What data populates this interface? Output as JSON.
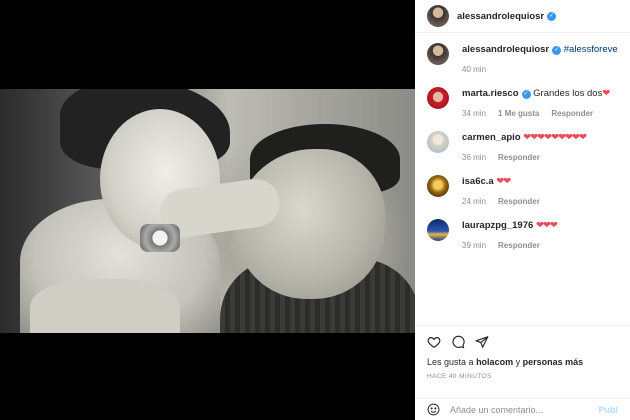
{
  "post_header": {
    "username": "alessandrolequiosr"
  },
  "caption": {
    "username": "alessandrolequiosr",
    "hashtags": "#alessforeve #lequiocity",
    "time": "40 min"
  },
  "comments": [
    {
      "username": "marta.riesco",
      "text": "Grandes los dos",
      "hearts": "❤",
      "time": "34 min",
      "likes": "1 Me gusta",
      "reply": "Responder"
    },
    {
      "username": "carmen_apio",
      "text": "",
      "hearts": "❤❤❤❤❤❤❤❤❤",
      "time": "36 min",
      "likes": "",
      "reply": "Responder"
    },
    {
      "username": "isa6c.a",
      "text": "",
      "hearts": "❤❤",
      "time": "24 min",
      "likes": "",
      "reply": "Responder"
    },
    {
      "username": "laurapzpg_1976",
      "text": "",
      "hearts": "❤❤❤",
      "time": "39 min",
      "likes": "",
      "reply": "Responder"
    }
  ],
  "likes_line": {
    "prefix": "Les gusta a",
    "user": "holacom",
    "middle": "y",
    "others": "personas más"
  },
  "timestamp": "HACE 40 MINUTOS",
  "comment_box": {
    "placeholder": "Añade un comentario...",
    "post_label": "Publ"
  },
  "icons": [
    "heart-icon",
    "comment-icon",
    "share-icon",
    "emoji-icon",
    "verified-icon"
  ],
  "colors": {
    "verified": "#3897f0",
    "heart": "#ed4956",
    "link": "#00376b",
    "post_disabled": "#b2dffc"
  }
}
